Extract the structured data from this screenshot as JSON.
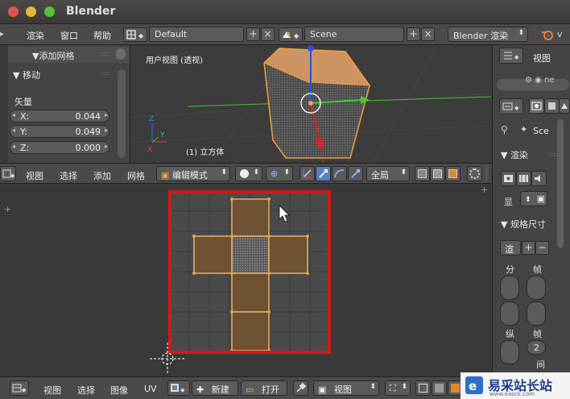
{
  "app": {
    "title": "Blender",
    "traffic_colors": [
      "#e4544f",
      "#e4b33a",
      "#57c038"
    ]
  },
  "info_header": {
    "menus": [
      "渲染",
      "窗口",
      "帮助"
    ],
    "layout_name": "Default",
    "scene_name": "Scene",
    "render_engine": "Blender 渲染"
  },
  "tool_panel": {
    "add_mesh_header": "▼添加网格",
    "move_header": "▼ 移动",
    "vector_label": "矢量",
    "fields": [
      {
        "label": "X:",
        "value": "0.044"
      },
      {
        "label": "Y:",
        "value": "0.049"
      },
      {
        "label": "Z:",
        "value": "0.000"
      }
    ]
  },
  "viewport": {
    "view_label": "用户视图 (透视)",
    "object_label": "(1) 立方体"
  },
  "view3d_header": {
    "menus": [
      "视图",
      "选择",
      "添加",
      "网格"
    ],
    "mode": "编辑模式",
    "pivot": "全局"
  },
  "uv_editor": {
    "menus": [
      "视图",
      "选择",
      "图像",
      "UV"
    ],
    "new_label": "新建",
    "open_label": "打开",
    "view_label": "视图",
    "highlight_color": "#d01a1a"
  },
  "properties": {
    "view_label": "视图",
    "scene_text": "Sce",
    "render_header": "▼ 渲染",
    "display_label": "显",
    "dimensions_header": "▼ 规格尺寸",
    "render_dd": "渲",
    "col1_label": "分",
    "col2_label": "帧",
    "col3_label": "纵",
    "col4_label": "帧",
    "spin_value": "2",
    "interval_label": "间"
  },
  "watermark": {
    "text": "易采站长站",
    "subtext": "www.easck.com"
  }
}
